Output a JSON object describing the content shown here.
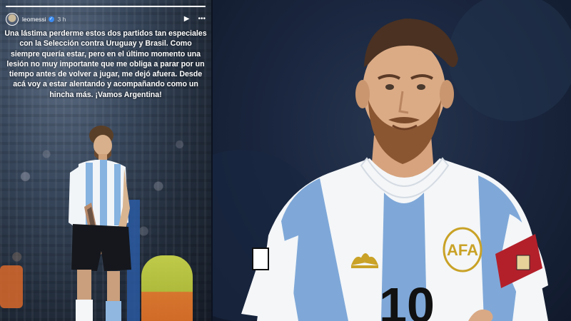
{
  "story": {
    "username": "leomessi",
    "time_ago": "3 h",
    "progress": 1.0,
    "caption": "Una lástima perderme estos dos partidos tan especiales con la Selección contra Uruguay y Brasil. Como siempre quería estar, pero en el último momento una lesión no muy importante que me obliga a parar por un tiempo antes de volver a jugar, me dejó afuera. Desde acá voy a estar alentando y acompañando como un hincha más. ¡Vamos Argentina!",
    "controls": {
      "play_icon": "play-icon",
      "more_icon": "more-icon"
    }
  },
  "photo": {
    "badge_text": "AFA",
    "shirt_number": "10",
    "colors": {
      "stripe_blue": "#7fa8d8",
      "shirt_white": "#f4f6f8",
      "armband_red": "#b3202a",
      "adidas_gold": "#c9a227"
    }
  }
}
